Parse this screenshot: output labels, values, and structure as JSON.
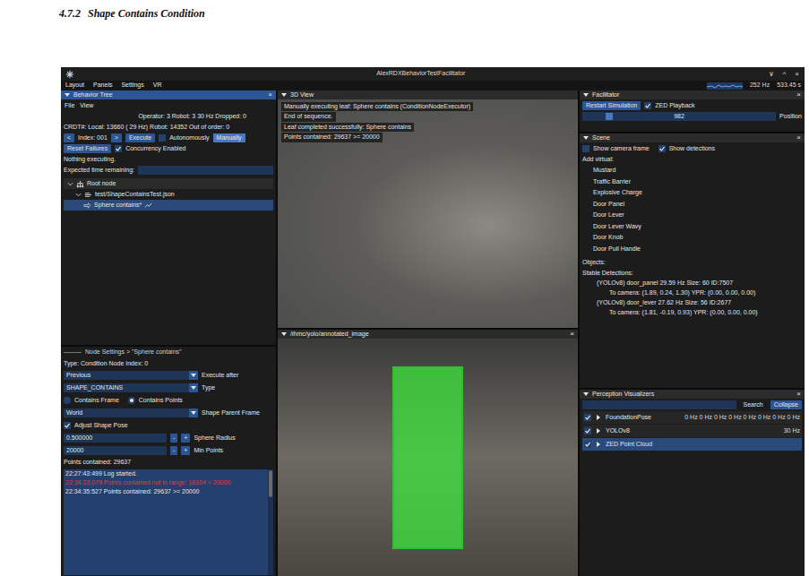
{
  "heading": {
    "number": "4.7.2",
    "title": "Shape Contains Condition"
  },
  "window": {
    "title": "AlexRDXBehaviorTestFacilitator",
    "controls": [
      "∨",
      "^",
      "×"
    ]
  },
  "menu": [
    "Layout",
    "Panels",
    "Settings",
    "VR"
  ],
  "status": {
    "rate": "252 Hz",
    "time": "533.45 s"
  },
  "behavior_tree": {
    "title": "Behavior Tree",
    "close": "×",
    "menu": [
      "File",
      "View"
    ],
    "sync": "Operator: 3 Robot: 3   30 Hz Dropped: 0",
    "crdt": "CRDT#: Local: 13660 ( 29 Hz)  Robot: 14352  Out of order: 0",
    "prev": "<",
    "index": "Index: 001",
    "next": ">",
    "execute": "Execute",
    "autonomously": {
      "label": "Autonomously",
      "checked": false
    },
    "manually": {
      "label": "Manually",
      "selected": true
    },
    "reset": "Reset Failures",
    "concurrency": {
      "label": "Concurrency Enabled",
      "checked": true
    },
    "executing": "Nothing executing.",
    "expected": {
      "label": "Expected time remaining:",
      "value": ""
    },
    "tree": {
      "label": "Root node",
      "kind": "root",
      "expanded": true,
      "selected": false,
      "children": [
        {
          "label": "test/ShapeContainsTest.json",
          "kind": "file",
          "expanded": true,
          "selected": false,
          "children": [
            {
              "label": "Sphere contains*",
              "kind": "condition",
              "selected": true
            }
          ]
        }
      ]
    }
  },
  "node_settings": {
    "title": "Node Settings > \"Sphere contains\"",
    "type_line": "Type: Condition Node   Index: 0",
    "fields": [
      {
        "kind": "dropdown",
        "value": "Previous",
        "label": "Execute after"
      },
      {
        "kind": "dropdown",
        "value": "SHAPE_CONTAINS",
        "label": "Type"
      },
      {
        "kind": "radio",
        "options": [
          {
            "label": "Contains Frame",
            "selected": false
          },
          {
            "label": "Contains Points",
            "selected": true
          }
        ]
      },
      {
        "kind": "dropdown",
        "value": "World",
        "label": "Shape Parent Frame"
      },
      {
        "kind": "checkbox",
        "label": "Adjust Shape Pose",
        "checked": true
      },
      {
        "kind": "stepper",
        "value": "0.500000",
        "minus": "-",
        "plus": "+",
        "label": "Sphere Radius"
      },
      {
        "kind": "stepper",
        "value": "20000",
        "minus": "-",
        "plus": "+",
        "label": "Min Points"
      },
      {
        "kind": "text",
        "label": "Points contained: 29637"
      }
    ],
    "log": [
      {
        "text": "22:27:43:499 Log started.",
        "color": "#e6e6e6"
      },
      {
        "text": "22:34:23:079 Points contained not in range: 16104 < 20000",
        "color": "#e23b3b"
      },
      {
        "text": "22:34:35:527 Points contained: 29637 >= 20000",
        "color": "#e6e6e6"
      }
    ]
  },
  "view_3d": {
    "title": "3D View",
    "overlay": [
      "Manually executing leaf: Sphere contains (ConditionNodeExecutor)",
      "End of sequence.",
      "Leaf completed successfully: Sphere contains",
      "Points contained: 29637 >= 20000"
    ]
  },
  "image_panel": {
    "title": "/ihmc/yolo/annotated_image",
    "close": "×"
  },
  "facilitator": {
    "title": "Facilitator",
    "close": "×",
    "restart": "Restart Simulation",
    "playback": {
      "label": "ZED Playback",
      "checked": true
    },
    "slider": {
      "value": "982",
      "level": 0.12,
      "label": "Position"
    }
  },
  "scene": {
    "title": "Scene",
    "close": "×",
    "toggles": [
      {
        "label": "Show camera frame",
        "checked": false
      },
      {
        "label": "Show detections",
        "checked": true
      }
    ],
    "add_label": "Add virtual:",
    "virtual": [
      "Mustard",
      "Traffic Barrier",
      "Explosive Charge",
      "Door Panel",
      "Door Lever",
      "Door Lever Wavy",
      "Door Knob",
      "Door Pull Handle"
    ],
    "objects_label": "Objects:",
    "stable_label": "Stable Detections:",
    "detections": [
      {
        "name": "(YOLOv8) door_panel 29.59 Hz Size: 60 ID:7507",
        "pose": "To camera: (1.89, 0.24, 1.30) YPR: (0.00, 0.00, 0.00)"
      },
      {
        "name": "(YOLOv8) door_lever 27.62 Hz Size: 56 ID:2677",
        "pose": "To camera: (1.81, -0.19, 0.93) YPR: (0.00, 0.00, 0.00)"
      }
    ]
  },
  "perception": {
    "title": "Perception Visualizers",
    "close": "×",
    "search": {
      "value": "",
      "button": "Search"
    },
    "collapse": "Collapse",
    "rows": [
      {
        "label": "FoundationPose",
        "checked": true,
        "expanded": false,
        "rate": "0 Hz 0 Hz 0 Hz 0 Hz 0 Hz 0 Hz 0 Hz 0 Hz",
        "selected": false
      },
      {
        "label": "YOLOv8",
        "checked": true,
        "expanded": false,
        "rate": "30 Hz",
        "selected": false
      },
      {
        "label": "ZED Point Cloud",
        "checked": true,
        "expanded": false,
        "rate": "",
        "selected": true
      }
    ]
  }
}
